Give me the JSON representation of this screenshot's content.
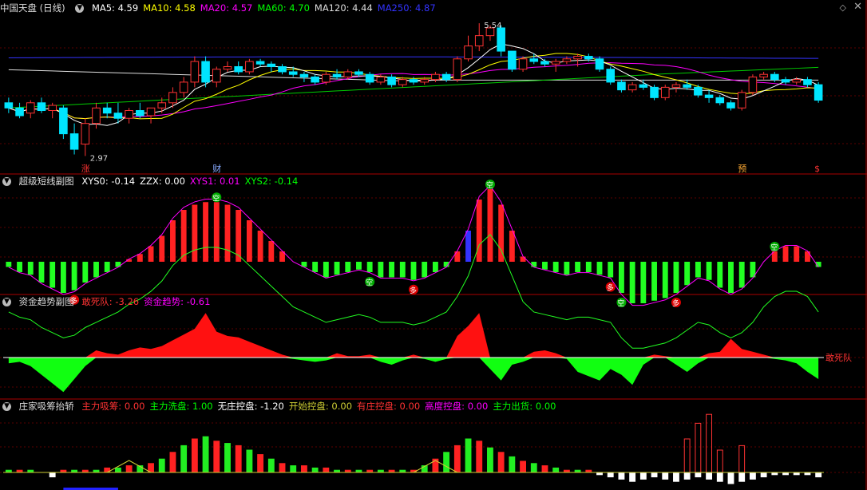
{
  "panels": {
    "main": {
      "title": "中国天盘 (日线)",
      "legend": [
        {
          "label": "MA5: 4.59",
          "color": "#ffffff"
        },
        {
          "label": "MA10: 4.58",
          "color": "#ffff00"
        },
        {
          "label": "MA20: 4.57",
          "color": "#ff00ff"
        },
        {
          "label": "MA60: 4.70",
          "color": "#00ff00"
        },
        {
          "label": "MA120: 4.44",
          "color": "#dddddd"
        },
        {
          "label": "MA250: 4.87",
          "color": "#3333ff"
        }
      ],
      "high_label": "5.54",
      "low_label": "2.97",
      "markers": [
        {
          "text": "涨",
          "color": "#ff3333"
        },
        {
          "text": "财",
          "color": "#88aaff"
        },
        {
          "text": "预",
          "color": "#ffaa33"
        },
        {
          "text": "$",
          "color": "#ff3333"
        }
      ]
    },
    "osc": {
      "title": "超级短线副图",
      "legend": [
        {
          "label": "XYS0: -0.14",
          "color": "#ffffff"
        },
        {
          "label": "ZZX: 0.00",
          "color": "#ffffff"
        },
        {
          "label": "XYS1: 0.01",
          "color": "#ff00ff"
        },
        {
          "label": "XYS2: -0.14",
          "color": "#00ff00"
        }
      ],
      "badge_long": "多",
      "badge_short": "空"
    },
    "fund": {
      "title": "资金趋势副图",
      "legend": [
        {
          "label": "敢死队: -3.26",
          "color": "#ff3333"
        },
        {
          "label": "资金趋势: -0.61",
          "color": "#ff00ff"
        }
      ],
      "right_label": "敢死队"
    },
    "chips": {
      "title": "庄家吸筹抬轿",
      "legend": [
        {
          "label": "主力吸筹: 0.00",
          "color": "#ff3333"
        },
        {
          "label": "主力洗盘: 1.00",
          "color": "#00ff00"
        },
        {
          "label": "无庄控盘: -1.20",
          "color": "#ffffff"
        },
        {
          "label": "开始控盘: 0.00",
          "color": "#cccc33"
        },
        {
          "label": "有庄控盘: 0.00",
          "color": "#ff3333"
        },
        {
          "label": "高度控盘: 0.00",
          "color": "#ff00ff"
        },
        {
          "label": "主力出货: 0.00",
          "color": "#00ff00"
        }
      ]
    }
  },
  "chart_data": {
    "type": "candlestick",
    "candles": [
      [
        4.0,
        4.1,
        3.8,
        3.9
      ],
      [
        3.9,
        4.0,
        3.7,
        3.75
      ],
      [
        3.8,
        4.05,
        3.7,
        4.0
      ],
      [
        4.0,
        4.1,
        3.8,
        3.85
      ],
      [
        3.85,
        4.0,
        3.7,
        3.95
      ],
      [
        3.9,
        3.95,
        3.3,
        3.4
      ],
      [
        3.4,
        3.6,
        3.0,
        3.1
      ],
      [
        3.2,
        3.7,
        2.97,
        3.6
      ],
      [
        3.6,
        4.0,
        3.5,
        3.9
      ],
      [
        3.9,
        4.0,
        3.7,
        3.8
      ],
      [
        3.8,
        4.0,
        3.6,
        3.7
      ],
      [
        3.7,
        3.9,
        3.6,
        3.85
      ],
      [
        3.85,
        4.0,
        3.7,
        3.75
      ],
      [
        3.75,
        3.9,
        3.6,
        3.9
      ],
      [
        3.9,
        4.1,
        3.8,
        4.0
      ],
      [
        4.0,
        4.3,
        3.9,
        4.2
      ],
      [
        4.2,
        4.5,
        4.1,
        4.4
      ],
      [
        4.4,
        4.9,
        4.3,
        4.8
      ],
      [
        4.8,
        4.9,
        4.3,
        4.4
      ],
      [
        4.4,
        4.7,
        4.3,
        4.65
      ],
      [
        4.65,
        4.8,
        4.6,
        4.7
      ],
      [
        4.7,
        4.8,
        4.55,
        4.6
      ],
      [
        4.6,
        4.85,
        4.55,
        4.8
      ],
      [
        4.8,
        4.85,
        4.7,
        4.75
      ],
      [
        4.75,
        4.8,
        4.6,
        4.7
      ],
      [
        4.7,
        4.75,
        4.55,
        4.6
      ],
      [
        4.6,
        4.7,
        4.5,
        4.55
      ],
      [
        4.55,
        4.6,
        4.4,
        4.5
      ],
      [
        4.5,
        4.55,
        4.35,
        4.4
      ],
      [
        4.4,
        4.6,
        4.35,
        4.55
      ],
      [
        4.55,
        4.65,
        4.45,
        4.5
      ],
      [
        4.5,
        4.65,
        4.45,
        4.6
      ],
      [
        4.6,
        4.65,
        4.5,
        4.55
      ],
      [
        4.55,
        4.6,
        4.35,
        4.4
      ],
      [
        4.4,
        4.55,
        4.35,
        4.5
      ],
      [
        4.5,
        4.55,
        4.3,
        4.35
      ],
      [
        4.35,
        4.5,
        4.3,
        4.45
      ],
      [
        4.45,
        4.5,
        4.35,
        4.4
      ],
      [
        4.4,
        4.5,
        4.35,
        4.45
      ],
      [
        4.45,
        4.6,
        4.4,
        4.55
      ],
      [
        4.55,
        4.6,
        4.4,
        4.45
      ],
      [
        4.45,
        4.9,
        4.4,
        4.85
      ],
      [
        4.85,
        5.3,
        4.8,
        5.1
      ],
      [
        5.1,
        5.54,
        5.0,
        5.3
      ],
      [
        5.3,
        5.5,
        5.2,
        5.45
      ],
      [
        5.45,
        5.5,
        4.9,
        5.0
      ],
      [
        5.0,
        5.0,
        4.6,
        4.65
      ],
      [
        4.65,
        4.9,
        4.6,
        4.85
      ],
      [
        4.85,
        4.95,
        4.75,
        4.8
      ],
      [
        4.8,
        4.85,
        4.7,
        4.75
      ],
      [
        4.75,
        4.85,
        4.6,
        4.8
      ],
      [
        4.8,
        4.9,
        4.75,
        4.85
      ],
      [
        4.85,
        4.95,
        4.7,
        4.9
      ],
      [
        4.9,
        4.95,
        4.8,
        4.85
      ],
      [
        4.85,
        4.9,
        4.6,
        4.65
      ],
      [
        4.65,
        4.7,
        4.35,
        4.4
      ],
      [
        4.4,
        4.45,
        4.2,
        4.25
      ],
      [
        4.25,
        4.4,
        4.2,
        4.35
      ],
      [
        4.35,
        4.45,
        4.25,
        4.3
      ],
      [
        4.3,
        4.35,
        4.05,
        4.1
      ],
      [
        4.1,
        4.35,
        4.05,
        4.3
      ],
      [
        4.3,
        4.4,
        4.2,
        4.35
      ],
      [
        4.35,
        4.45,
        4.25,
        4.3
      ],
      [
        4.3,
        4.35,
        4.1,
        4.15
      ],
      [
        4.15,
        4.25,
        4.0,
        4.1
      ],
      [
        4.1,
        4.15,
        3.95,
        4.0
      ],
      [
        4.0,
        4.05,
        3.85,
        3.9
      ],
      [
        3.9,
        4.25,
        3.85,
        4.2
      ],
      [
        4.2,
        4.55,
        4.15,
        4.5
      ],
      [
        4.5,
        4.6,
        4.45,
        4.55
      ],
      [
        4.55,
        4.6,
        4.4,
        4.45
      ],
      [
        4.45,
        4.5,
        4.35,
        4.4
      ],
      [
        4.4,
        4.5,
        4.35,
        4.45
      ],
      [
        4.45,
        4.5,
        4.3,
        4.35
      ],
      [
        4.35,
        4.4,
        4.0,
        4.05
      ]
    ],
    "osc": [
      -0.1,
      -0.2,
      -0.25,
      -0.4,
      -0.5,
      -0.6,
      -0.55,
      -0.4,
      -0.3,
      -0.2,
      -0.1,
      0.05,
      0.15,
      0.3,
      0.5,
      0.8,
      1.0,
      1.1,
      1.15,
      1.15,
      1.1,
      1.0,
      0.8,
      0.6,
      0.4,
      0.2,
      0.0,
      -0.1,
      -0.2,
      -0.3,
      -0.25,
      -0.2,
      -0.15,
      -0.2,
      -0.3,
      -0.3,
      -0.3,
      -0.35,
      -0.3,
      -0.2,
      -0.1,
      0.2,
      0.6,
      1.2,
      1.4,
      1.1,
      0.6,
      0.1,
      -0.1,
      -0.15,
      -0.2,
      -0.25,
      -0.2,
      -0.2,
      -0.25,
      -0.3,
      -0.6,
      -0.8,
      -0.8,
      -0.75,
      -0.7,
      -0.6,
      -0.45,
      -0.3,
      -0.35,
      -0.5,
      -0.6,
      -0.5,
      -0.3,
      0.0,
      0.2,
      0.3,
      0.3,
      0.2,
      -0.1
    ],
    "osc_blue_index": 42,
    "fund": [
      -0.4,
      -0.3,
      -0.6,
      -1.2,
      -1.8,
      -2.4,
      -1.5,
      -0.6,
      0.5,
      0.3,
      0.2,
      0.5,
      0.7,
      0.6,
      0.8,
      1.2,
      1.6,
      2.0,
      3.1,
      1.8,
      1.5,
      1.4,
      1.1,
      0.8,
      0.5,
      0.2,
      -0.1,
      -0.2,
      -0.3,
      -0.2,
      0.3,
      0.1,
      0.1,
      0.2,
      -0.3,
      -0.5,
      -0.2,
      0.2,
      -0.1,
      -0.3,
      -0.1,
      1.5,
      2.2,
      3.1,
      -0.8,
      -1.6,
      -0.5,
      -0.3,
      0.4,
      0.5,
      0.3,
      -0.1,
      -1.0,
      -1.3,
      -1.6,
      -0.8,
      -1.2,
      -1.9,
      -0.5,
      0.2,
      0.1,
      -0.5,
      -1.0,
      -0.4,
      0.3,
      0.4,
      1.3,
      0.6,
      0.4,
      0.2,
      -0.1,
      -0.2,
      -0.4,
      -1.0,
      -1.5
    ],
    "chips": [
      0.1,
      0.1,
      0.1,
      0,
      -0.2,
      0.1,
      0.1,
      0.1,
      0.1,
      0.2,
      0.2,
      0.3,
      0.3,
      0.4,
      0.6,
      0.9,
      1.2,
      1.5,
      1.6,
      1.4,
      1.3,
      1.2,
      1.0,
      0.8,
      0.6,
      0.4,
      0.3,
      0.3,
      0.2,
      0.2,
      0.1,
      0.1,
      0.1,
      0.1,
      0.1,
      0.1,
      0.1,
      0.1,
      0.3,
      0.6,
      0.9,
      1.2,
      1.5,
      1.4,
      1.1,
      0.9,
      0.7,
      0.5,
      0.4,
      0.3,
      0.2,
      0.1,
      0.1,
      0.1,
      -0.1,
      -0.2,
      -0.3,
      -0.4,
      -0.3,
      -0.2,
      -0.3,
      -0.4,
      -0.3,
      -0.2,
      -0.3,
      -0.4,
      -0.5,
      -0.4,
      -0.3,
      -0.2,
      -0.1,
      -0.1,
      -0.1,
      -0.1,
      -0.2
    ]
  }
}
